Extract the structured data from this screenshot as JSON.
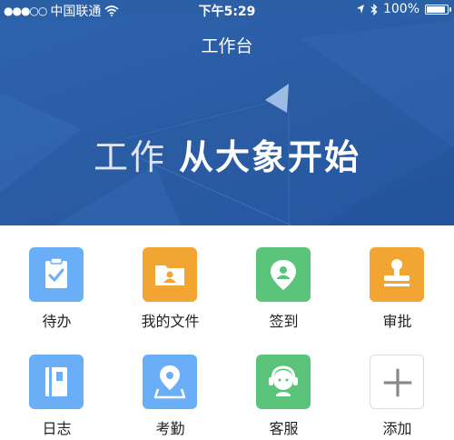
{
  "status_bar": {
    "carrier": "中国联通",
    "time": "下午5:29",
    "battery": "100%",
    "battery_level": 1.0,
    "signal_icon": "signal-dots-icon",
    "wifi_icon": "wifi-icon",
    "location_icon": "location-arrow-icon",
    "bluetooth_icon": "bluetooth-icon"
  },
  "header": {
    "title": "工作台"
  },
  "banner": {
    "slogan_light": "工作 ",
    "slogan_bold": "从大象开始"
  },
  "apps": [
    {
      "label": "待办",
      "icon": "clipboard-check-icon",
      "color": "#6aaef8"
    },
    {
      "label": "我的文件",
      "icon": "folder-user-icon",
      "color": "#f3a533"
    },
    {
      "label": "签到",
      "icon": "map-pin-icon",
      "color": "#5ac57a"
    },
    {
      "label": "审批",
      "icon": "stamp-icon",
      "color": "#f3a533"
    },
    {
      "label": "日志",
      "icon": "notebook-icon",
      "color": "#6aaef8"
    },
    {
      "label": "考勤",
      "icon": "location-marker-icon",
      "color": "#6aaef8"
    },
    {
      "label": "客服",
      "icon": "headset-agent-icon",
      "color": "#5ac57a"
    },
    {
      "label": "添加",
      "icon": "plus-icon",
      "color": "#ffffff"
    }
  ]
}
